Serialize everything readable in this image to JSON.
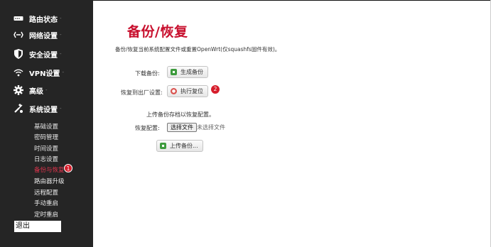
{
  "sidebar": {
    "menu": [
      {
        "label": "路由状态",
        "icon": "router-status-icon"
      },
      {
        "label": "网络设置",
        "icon": "network-icon"
      },
      {
        "label": "安全设置",
        "icon": "shield-icon"
      },
      {
        "label": "VPN设置",
        "icon": "vpn-icon"
      },
      {
        "label": "高级",
        "icon": "gear-icon"
      },
      {
        "label": "系统设置",
        "icon": "tools-icon"
      }
    ],
    "caret": "-",
    "submenu": [
      "基础设置",
      "密码管理",
      "时间设置",
      "日志设置",
      "备份与恢复",
      "路由器升级",
      "远程配置",
      "手动重启",
      "定时重启"
    ],
    "active_badge": "1",
    "logout": "退出"
  },
  "main": {
    "title": "备份/恢复",
    "description": "备份/恢复当前系统配置文件或重置OpenWrt(仅squashfs固件有效)。",
    "download_label": "下载备份:",
    "generate_button": "生成备份",
    "reset_label": "恢复到出厂设置:",
    "reset_button": "执行复位",
    "reset_badge": "2",
    "upload_hint": "上传备份存档以恢复配置。",
    "restore_label": "恢复配置:",
    "choose_file": "选择文件",
    "no_file": "未选择文件",
    "upload_button": "上传备份..."
  },
  "colors": {
    "accent": "#c8102e",
    "sidebar_bg": "#252525",
    "badge": "#d61d2b"
  }
}
